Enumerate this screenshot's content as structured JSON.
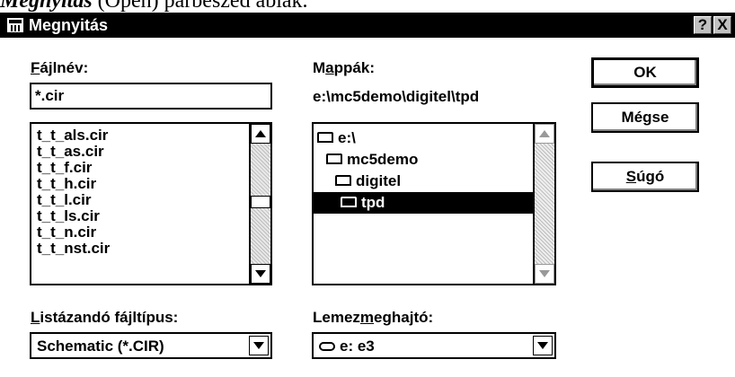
{
  "caption": {
    "bold_text": "Megnyitás",
    "rest_text": " (Open) párbeszéd ablak."
  },
  "dialog": {
    "title": "Megnyitás",
    "help_btn": "?",
    "close_btn": "X"
  },
  "filename": {
    "label_ul": "F",
    "label_rest": "ájlnév:",
    "value": "*.cir",
    "files": [
      "t_t_als.cir",
      "t_t_as.cir",
      "t_t_f.cir",
      "t_t_h.cir",
      "t_t_l.cir",
      "t_t_ls.cir",
      "t_t_n.cir",
      "t_t_nst.cir"
    ]
  },
  "folders": {
    "label_pre": "M",
    "label_ul": "a",
    "label_rest": "ppák:",
    "path": "e:\\mc5demo\\digitel\\tpd",
    "items": [
      "e:\\",
      "mc5demo",
      "digitel",
      "tpd"
    ],
    "selected_index": 3
  },
  "buttons": {
    "ok": "OK",
    "cancel": "Mégse",
    "help_ul": "S",
    "help_rest": "úgó"
  },
  "filetype": {
    "label_ul": "L",
    "label_rest": "istázandó fájltípus:",
    "value": "Schematic (*.CIR)"
  },
  "drive": {
    "label_pre": "Lemez",
    "label_ul": "m",
    "label_rest": "eghajtó:",
    "value": "e: e3"
  }
}
